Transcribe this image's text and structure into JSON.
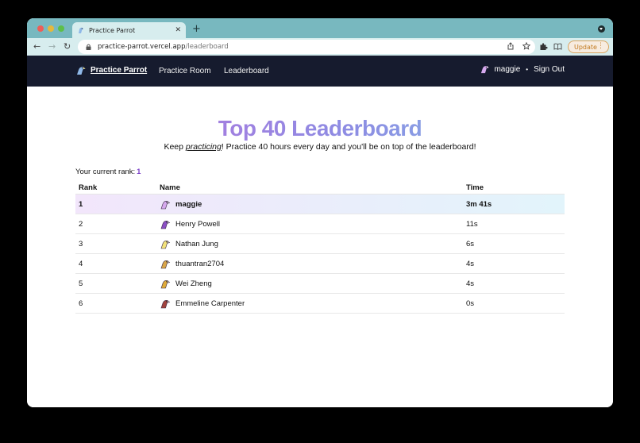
{
  "browser": {
    "tab_title": "Practice Parrot",
    "url_host": "practice-parrot.vercel.app",
    "url_path": "/leaderboard",
    "update_label": "Update"
  },
  "nav": {
    "brand": "Practice Parrot",
    "links": [
      "Practice Room",
      "Leaderboard"
    ],
    "username": "maggie",
    "separator": "•",
    "sign_out": "Sign Out"
  },
  "page": {
    "title": "Top 40 Leaderboard",
    "subtitle_pre": "Keep ",
    "subtitle_em": "practicing",
    "subtitle_post": "! Practice 40 hours every day and you'll be on top of the leaderboard!",
    "rank_label": "Your current rank:",
    "rank_value": "1"
  },
  "table": {
    "headers": [
      "Rank",
      "Name",
      "Time"
    ],
    "rows": [
      {
        "rank": "1",
        "name": "maggie",
        "time": "3m 41s",
        "parrot_color": "#d6a9ee"
      },
      {
        "rank": "2",
        "name": "Henry Powell",
        "time": "11s",
        "parrot_color": "#8b4fc4"
      },
      {
        "rank": "3",
        "name": "Nathan Jung",
        "time": "6s",
        "parrot_color": "#f2e27a"
      },
      {
        "rank": "4",
        "name": "thuantran2704",
        "time": "4s",
        "parrot_color": "#d9a64a"
      },
      {
        "rank": "5",
        "name": "Wei Zheng",
        "time": "4s",
        "parrot_color": "#dfab3a"
      },
      {
        "rank": "6",
        "name": "Emmeline Carpenter",
        "time": "0s",
        "parrot_color": "#a2433f"
      }
    ]
  },
  "colors": {
    "nav_bg": "#161b2e",
    "accent": "#7a3fc7",
    "brand_parrot": "#8fb8e8",
    "user_parrot": "#d6a9ee"
  }
}
